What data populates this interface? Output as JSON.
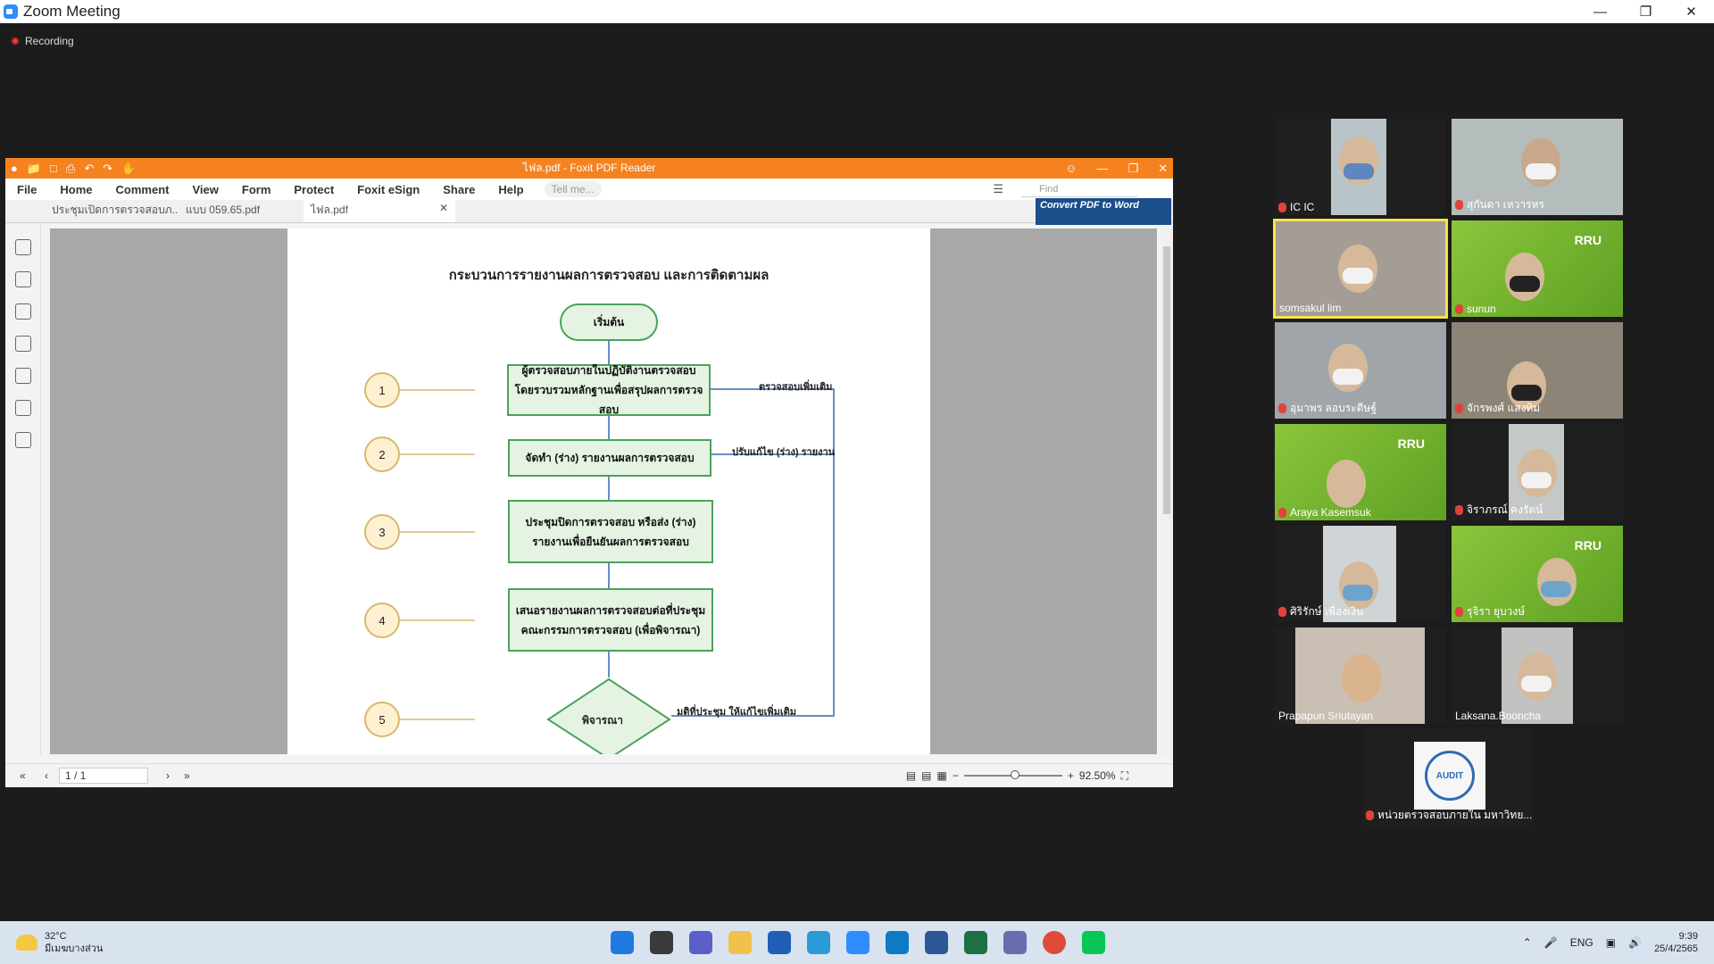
{
  "window": {
    "title": "Zoom Meeting",
    "recording": "Recording"
  },
  "foxit": {
    "title": "ไฟล.pdf - Foxit PDF Reader",
    "menus": [
      "File",
      "Home",
      "Comment",
      "View",
      "Form",
      "Protect",
      "Foxit eSign",
      "Share",
      "Help"
    ],
    "tell_me": "Tell me...",
    "find_placeholder": "Find",
    "tabs": [
      "ประชุมเปิดการตรวจสอบภ...",
      "แบบ 059.65.pdf",
      "ไฟล.pdf"
    ],
    "convert": "Convert PDF to Word",
    "page_indicator": "1 / 1",
    "zoom": "92.50%"
  },
  "flowchart": {
    "title": "กระบวนการรายงานผลการตรวจสอบ และการติดตามผล",
    "start": "เริ่มต้น",
    "steps": [
      {
        "num": "1",
        "line1": "ผู้ตรวจสอบภายในปฏิบัติงานตรวจสอบ",
        "line2": "โดยรวบรวมหลักฐานเพื่อสรุปผลการตรวจสอบ"
      },
      {
        "num": "2",
        "line1": "จัดทำ (ร่าง) รายงานผลการตรวจสอบ",
        "line2": ""
      },
      {
        "num": "3",
        "line1": "ประชุมปิดการตรวจสอบ หรือส่ง (ร่าง)",
        "line2": "รายงานเพื่อยืนยันผลการตรวจสอบ"
      },
      {
        "num": "4",
        "line1": "เสนอรายงานผลการตรวจสอบต่อที่ประชุม",
        "line2": "คณะกรรมการตรวจสอบ (เพื่อพิจารณา)"
      }
    ],
    "decision_num": "5",
    "decision": "พิจารณา",
    "feedback_1": "ตรวจสอบเพิ่มเติม",
    "feedback_2": "ปรับแก้ไข (ร่าง) รายงาน",
    "feedback_3": "มติที่ประชุม ให้แก้ไขเพิ่มเติม"
  },
  "participants": [
    {
      "name": "IC IC"
    },
    {
      "name": "สุกันดา  เหวารหร"
    },
    {
      "name": "somsakul lim"
    },
    {
      "name": "sunun"
    },
    {
      "name": "อุมาพร  ลอบระดีษฐ์"
    },
    {
      "name": "จักรพงศ์  แสงทิม"
    },
    {
      "name": "Araya  Kasemsuk"
    },
    {
      "name": "จิราภรณ์  คงรัตน์"
    },
    {
      "name": "ศิริรักษ์  เพื่องเงิน"
    },
    {
      "name": "รุจิรา  ยุบวงษ์"
    },
    {
      "name": "Prapapun Sriutayan"
    },
    {
      "name": "Laksana.Booncha"
    },
    {
      "name": "หน่วยตรวจสอบภายใน มหาวิทย..."
    }
  ],
  "tile_logos": {
    "rru": "RRU",
    "audit": "AUDIT"
  },
  "taskbar": {
    "weather_temp": "32°C",
    "weather_desc": "มีเมฆบางส่วน",
    "lang": "ENG",
    "time": "9:39",
    "date": "25/4/2565"
  }
}
